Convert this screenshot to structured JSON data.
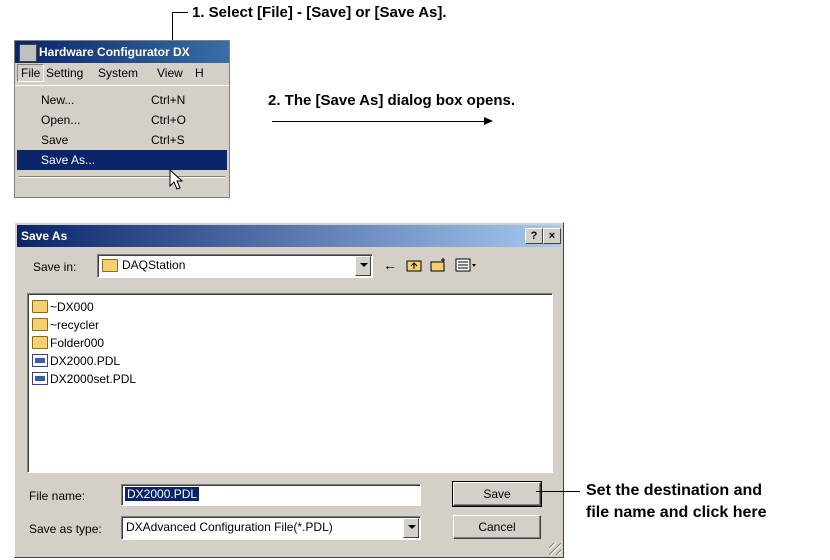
{
  "callouts": {
    "step1": "1. Select [File] - [Save] or [Save As].",
    "step2": "2. The [Save As] dialog box opens.",
    "step3_line1": "Set the destination and",
    "step3_line2": "file name and click here"
  },
  "app": {
    "title": "Hardware Configurator DX",
    "menu": [
      "File",
      "Setting",
      "System",
      "View",
      "H"
    ],
    "file_menu": [
      {
        "label": "New...",
        "shortcut": "Ctrl+N"
      },
      {
        "label": "Open...",
        "shortcut": "Ctrl+O"
      },
      {
        "label": "Save",
        "shortcut": "Ctrl+S"
      },
      {
        "label": "Save As...",
        "shortcut": ""
      }
    ]
  },
  "dialog": {
    "title": "Save As",
    "help_btn": "?",
    "close_btn": "×",
    "save_in_label": "Save in:",
    "save_in_value": "DAQStation",
    "files": [
      {
        "name": "~DX000",
        "type": "folder"
      },
      {
        "name": "~recycler",
        "type": "folder"
      },
      {
        "name": "Folder000",
        "type": "folder"
      },
      {
        "name": "DX2000.PDL",
        "type": "file"
      },
      {
        "name": "DX2000set.PDL",
        "type": "file"
      }
    ],
    "file_name_label": "File name:",
    "file_name_value": "DX2000.PDL",
    "save_type_label": "Save as type:",
    "save_type_value": "DXAdvanced Configuration File(*.PDL)",
    "save_btn": "Save",
    "cancel_btn": "Cancel",
    "toolbar_icons": [
      "back-arrow-icon",
      "up-folder-icon",
      "new-folder-icon",
      "view-menu-icon"
    ]
  }
}
